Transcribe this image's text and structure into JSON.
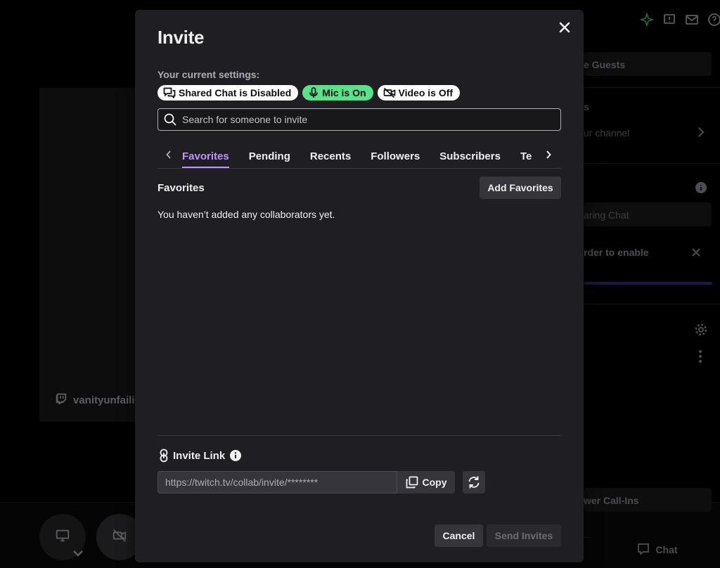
{
  "background": {
    "stage_username": "vanityunfaili",
    "right_panel": {
      "guests_label": "e Guests",
      "section_label": "s",
      "channel_row": "ur channel",
      "sharing_chat": "aring Chat",
      "enable_text": "rder to enable",
      "call_ins": "wer Call-Ins",
      "chat_button": "Chat"
    }
  },
  "modal": {
    "title": "Invite",
    "current_settings_label": "Your current settings:",
    "settings": [
      {
        "label": "Shared Chat is Disabled",
        "icon": "chat-bubbles-icon",
        "color": "#ffffff"
      },
      {
        "label": "Mic is On",
        "icon": "microphone-icon",
        "color": "#57e389"
      },
      {
        "label": "Video is Off",
        "icon": "video-off-icon",
        "color": "#ffffff"
      }
    ],
    "search": {
      "placeholder": "Search for someone to invite",
      "value": ""
    },
    "tabs": [
      {
        "label": "Favorites",
        "active": true
      },
      {
        "label": "Pending",
        "active": false
      },
      {
        "label": "Recents",
        "active": false
      },
      {
        "label": "Followers",
        "active": false
      },
      {
        "label": "Subscribers",
        "active": false
      },
      {
        "label": "Te",
        "active": false
      }
    ],
    "section_title": "Favorites",
    "add_favorites_label": "Add Favorites",
    "empty_message": "You haven’t added any collaborators yet.",
    "invite_link": {
      "label": "Invite Link",
      "url": "https://twitch.tv/collab/invite/********",
      "copy_label": "Copy"
    },
    "cancel_label": "Cancel",
    "send_label": "Send Invites"
  },
  "colors": {
    "accent": "#bf94ff",
    "mic_on": "#57e389",
    "modal_bg": "#1f1f23"
  }
}
